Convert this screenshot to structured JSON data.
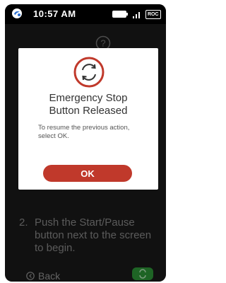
{
  "status_bar": {
    "time": "10:57 AM",
    "badge": "ROC",
    "logo_icon": "brand-logo-icon",
    "battery_icon": "battery-icon",
    "signal_icon": "signal-icon"
  },
  "background": {
    "step2": {
      "number": "2.",
      "text": "Push the Start/Pause button next to the screen to begin."
    },
    "back_label": "Back",
    "help_icon": "help-icon"
  },
  "dialog": {
    "icon": "emergency-stop-released-icon",
    "title_line1": "Emergency Stop",
    "title_line2": "Button Released",
    "message": "To resume the previous action, select OK.",
    "ok_label": "OK"
  },
  "colors": {
    "accent_red": "#c0392b",
    "status_green": "#2f9a3a",
    "screen_bg": "#1b1b1b"
  }
}
